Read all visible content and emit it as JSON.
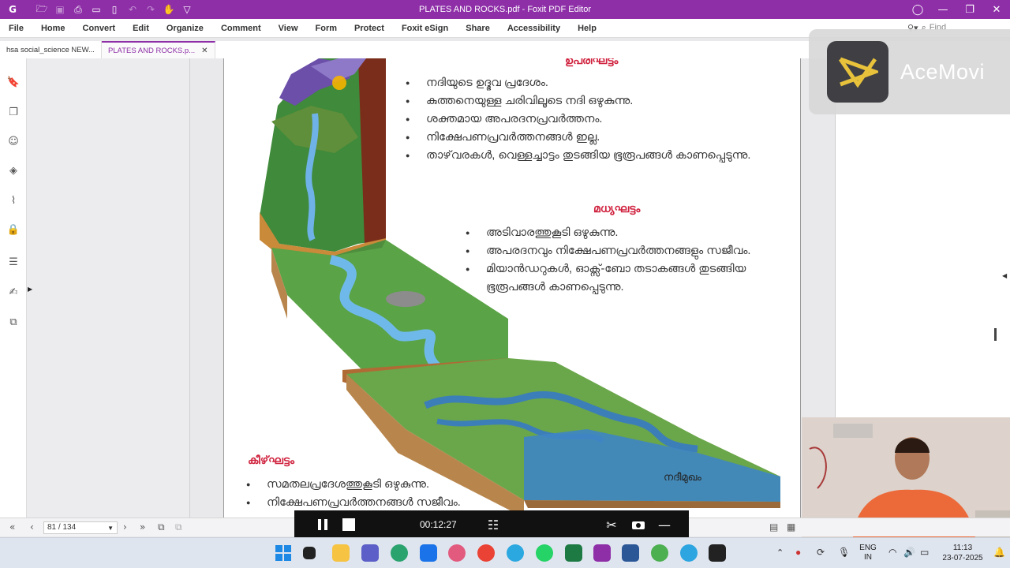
{
  "window": {
    "title": "PLATES AND ROCKS.pdf - Foxit PDF Editor",
    "minimize": "—",
    "maximize": "❐",
    "close": "✕"
  },
  "menu": [
    "File",
    "Home",
    "Convert",
    "Edit",
    "Organize",
    "Comment",
    "View",
    "Form",
    "Protect",
    "Foxit eSign",
    "Share",
    "Accessibility",
    "Help"
  ],
  "search": {
    "placeholder": "Find"
  },
  "tabs": [
    {
      "label": "hsa social_science NEW..."
    },
    {
      "label": "PLATES AND ROCKS.p...",
      "close": "✕"
    }
  ],
  "document": {
    "upper": {
      "heading": "ഉപരിഘട്ടം",
      "items": [
        "നദിയുടെ ഉദ്ഭവ പ്രദേശം.",
        "കുത്തനെയുള്ള ചരിവിലൂടെ നദി ഒഴുകുന്നു.",
        "ശക്തമായ അപരദനപ്രവർത്തനം.",
        "നിക്ഷേപണപ്രവർത്തനങ്ങൾ ഇല്ല.",
        "താഴ്‌വരകൾ, വെള്ളച്ചാട്ടം തുടങ്ങിയ ഭൂരൂപങ്ങൾ കാണപ്പെടുന്നു."
      ]
    },
    "middle": {
      "heading": "മധ്യഘട്ടം",
      "items": [
        "അടിവാരത്തുകൂടി ഒഴുകുന്നു.",
        "അപരദനവും നിക്ഷേപണപ്രവർത്തനങ്ങളും സജീവം.",
        "മിയാൻഡറുകൾ, ഓക്സ്-ബോ തടാകങ്ങൾ തുടങ്ങിയ ഭൂരൂപങ്ങൾ കാണപ്പെടുന്നു."
      ]
    },
    "lower": {
      "heading": "കീഴ്‌ഘട്ടം",
      "items": [
        "സമതലപ്രദേശത്തുകൂടി ഒഴുകുന്നു.",
        "നിക്ഷേപണപ്രവർത്തനങ്ങൾ സജീവം."
      ]
    },
    "delta_label": "നദീമുഖം"
  },
  "statusbar": {
    "page": "81 / 134"
  },
  "recorder": {
    "time": "00:12:27"
  },
  "watermark": {
    "text": "AceMovi"
  },
  "tray": {
    "lang_1": "ENG",
    "lang_2": "IN",
    "time": "11:13",
    "date": "23-07-2025"
  },
  "colors": {
    "titlebar": "#8e2fa8",
    "heading_red": "#d0233f",
    "accent_purple": "#8e2fa8"
  }
}
